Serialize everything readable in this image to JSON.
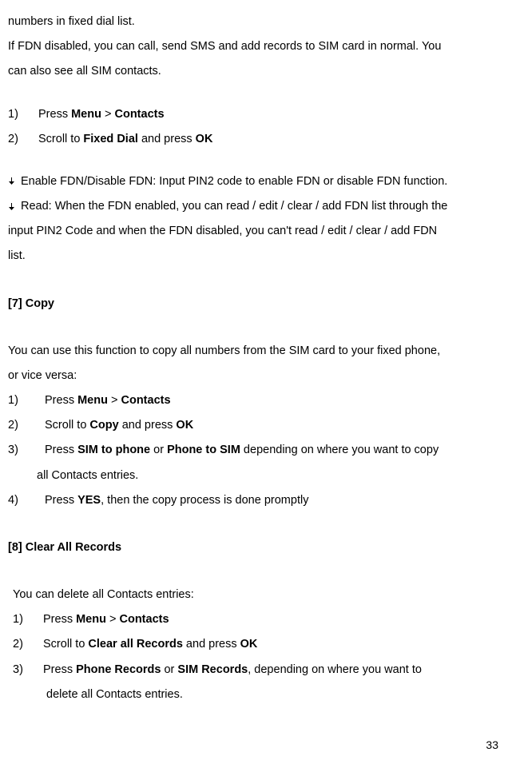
{
  "top": {
    "line1": "numbers in fixed dial list.",
    "line2a": "If FDN disabled, you can call, send SMS and add records to SIM card in normal. You",
    "line2b": "can also see all SIM contacts."
  },
  "steps_a": {
    "n1": "1)",
    "t1a": "Press ",
    "t1b": "Menu",
    "t1c": " > ",
    "t1d": "Contacts",
    "n2": "2)",
    "t2a": "Scroll to ",
    "t2b": "Fixed Dial",
    "t2c": " and press ",
    "t2d": "OK"
  },
  "arrow": {
    "a1": "Enable FDN/Disable FDN: Input PIN2 code to enable FDN or disable FDN function.",
    "a2a": "Read: When the FDN enabled, you can read / edit / clear / add FDN list through the",
    "a2b": "input PIN2 Code and when the FDN disabled, you can't read / edit / clear / add FDN",
    "a2c": "list."
  },
  "section7": {
    "heading": "[7]    Copy",
    "intro1": "You can use this function to copy all numbers from the SIM card to your fixed phone,",
    "intro2": "or vice versa:",
    "n1": "1)",
    "t1a": "Press ",
    "t1b": "Menu",
    "t1c": " > ",
    "t1d": "Contacts",
    "n2": "2)",
    "t2a": "Scroll to ",
    "t2b": "Copy",
    "t2c": " and press ",
    "t2d": "OK",
    "n3": "3)",
    "t3a": "Press ",
    "t3b": "SIM to phone",
    "t3c": " or ",
    "t3d": "Phone to SIM",
    "t3e": " depending on where you want to copy",
    "t3f": "all Contacts entries.",
    "n4": "4)",
    "t4a": "Press ",
    "t4b": "YES",
    "t4c": ", then the copy process is done promptly"
  },
  "section8": {
    "heading": "[8]    Clear All Records",
    "intro": "You can delete all Contacts entries:",
    "n1": "1)",
    "t1a": "Press ",
    "t1b": "Menu",
    "t1c": " > ",
    "t1d": "Contacts",
    "n2": "2)",
    "t2a": "Scroll to ",
    "t2b": "Clear all Records",
    "t2c": " and press ",
    "t2d": "OK",
    "n3": "3)",
    "t3a": "Press  ",
    "t3b": "Phone  Records",
    "t3c": "  or  ",
    "t3d": "SIM  Records",
    "t3e": ",  depending  on  where  you  want  to",
    "t3f": "delete all Contacts entries."
  },
  "page_number": "33"
}
